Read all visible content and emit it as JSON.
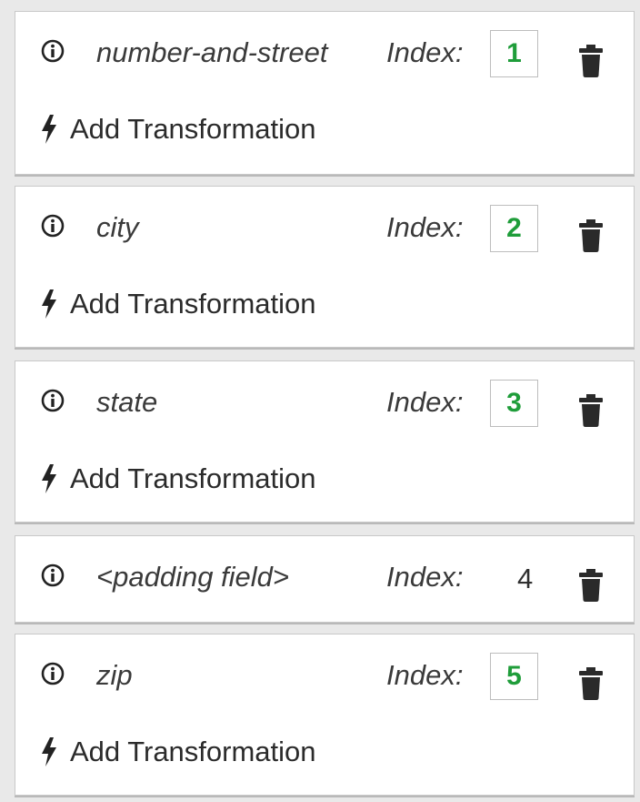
{
  "fields": [
    {
      "name": "number-and-street",
      "index_label": "Index:",
      "index": "1",
      "editable": true,
      "transformation_label": "Add Transformation"
    },
    {
      "name": "city",
      "index_label": "Index:",
      "index": "2",
      "editable": true,
      "transformation_label": "Add Transformation"
    },
    {
      "name": "state",
      "index_label": "Index:",
      "index": "3",
      "editable": true,
      "transformation_label": "Add Transformation"
    },
    {
      "name": "<padding field>",
      "index_label": "Index:",
      "index": "4",
      "editable": false
    },
    {
      "name": "zip",
      "index_label": "Index:",
      "index": "5",
      "editable": true,
      "transformation_label": "Add Transformation"
    }
  ],
  "icons": {
    "info": "info-circle-icon",
    "delete": "trash-icon",
    "transformation": "bolt-icon"
  },
  "colors": {
    "index_value": "#1f9d3a",
    "background": "#e9e9e9",
    "card": "#ffffff"
  }
}
